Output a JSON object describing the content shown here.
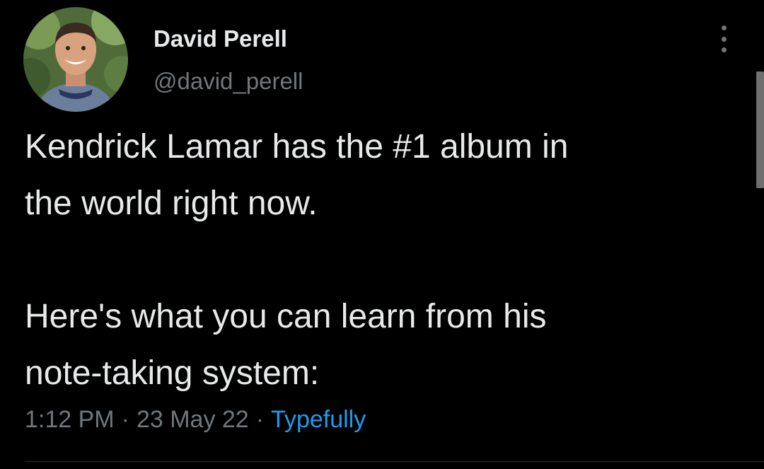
{
  "tweet": {
    "author": {
      "display_name": "David Perell",
      "handle": "@david_perell"
    },
    "text_paragraphs": [
      "Kendrick Lamar has the #1 album in\nthe world right now.",
      "Here's what you can learn from his\nnote-taking system:"
    ],
    "meta": {
      "time": "1:12 PM",
      "separator": "·",
      "date": "23 May 22",
      "source": "Typefully"
    },
    "more_icon": "more-vertical-icon"
  },
  "colors": {
    "background": "#000000",
    "text_primary": "#e7e9ea",
    "text_secondary": "#71767b",
    "link": "#1d9bf0",
    "divider": "#2f3336"
  }
}
